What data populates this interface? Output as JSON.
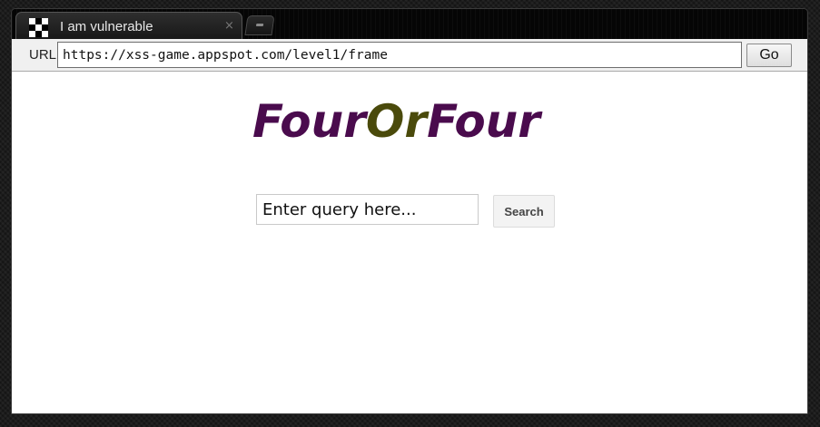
{
  "browser": {
    "tab_title": "I am vulnerable",
    "tab_close": "×",
    "url_label": "URL",
    "url_value": "https://xss-game.appspot.com/level1/frame",
    "go_label": "Go"
  },
  "page": {
    "logo": {
      "part1": "Four",
      "part2": "Or",
      "part3": "Four",
      "color_primary": "#4a0b4d",
      "color_accent": "#4a4a0b"
    },
    "search": {
      "placeholder": "Enter query here...",
      "button_label": "Search"
    }
  },
  "icons": {
    "favicon": "checkered-favicon-icon",
    "close": "close-icon",
    "new_tab": "new-tab-icon"
  }
}
